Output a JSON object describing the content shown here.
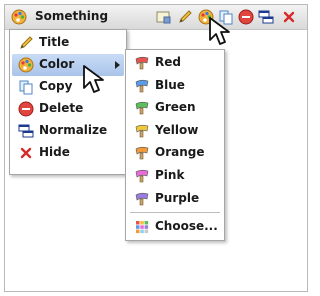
{
  "node": {
    "title": "Something",
    "icon": "palette-icon"
  },
  "toolbar": [
    {
      "name": "note-icon"
    },
    {
      "name": "pencil-icon"
    },
    {
      "name": "palette-icon"
    },
    {
      "name": "copy-icon"
    },
    {
      "name": "delete-icon"
    },
    {
      "name": "normalize-icon"
    },
    {
      "name": "close-icon"
    }
  ],
  "context_menu": {
    "items": [
      {
        "label": "Title",
        "icon": "pencil-icon"
      },
      {
        "label": "Color",
        "icon": "palette-icon",
        "selected": true,
        "has_submenu": true
      },
      {
        "label": "Copy",
        "icon": "copy-icon"
      },
      {
        "label": "Delete",
        "icon": "delete-icon"
      },
      {
        "label": "Normalize",
        "icon": "normalize-icon"
      },
      {
        "label": "Hide",
        "icon": "close-icon"
      }
    ]
  },
  "color_menu": {
    "items": [
      {
        "label": "Red",
        "color": "#e8534f"
      },
      {
        "label": "Blue",
        "color": "#5b9ae6"
      },
      {
        "label": "Green",
        "color": "#5cc05a"
      },
      {
        "label": "Yellow",
        "color": "#f0c93a"
      },
      {
        "label": "Orange",
        "color": "#f2993a"
      },
      {
        "label": "Pink",
        "color": "#e76bd8"
      },
      {
        "label": "Purple",
        "color": "#9a7be0"
      }
    ],
    "choose": {
      "label": "Choose...",
      "icon": "color-grid-icon"
    }
  },
  "colors": {
    "selection": "#b7cdee",
    "delete": "#e0463f",
    "close": "#d62b2b"
  }
}
